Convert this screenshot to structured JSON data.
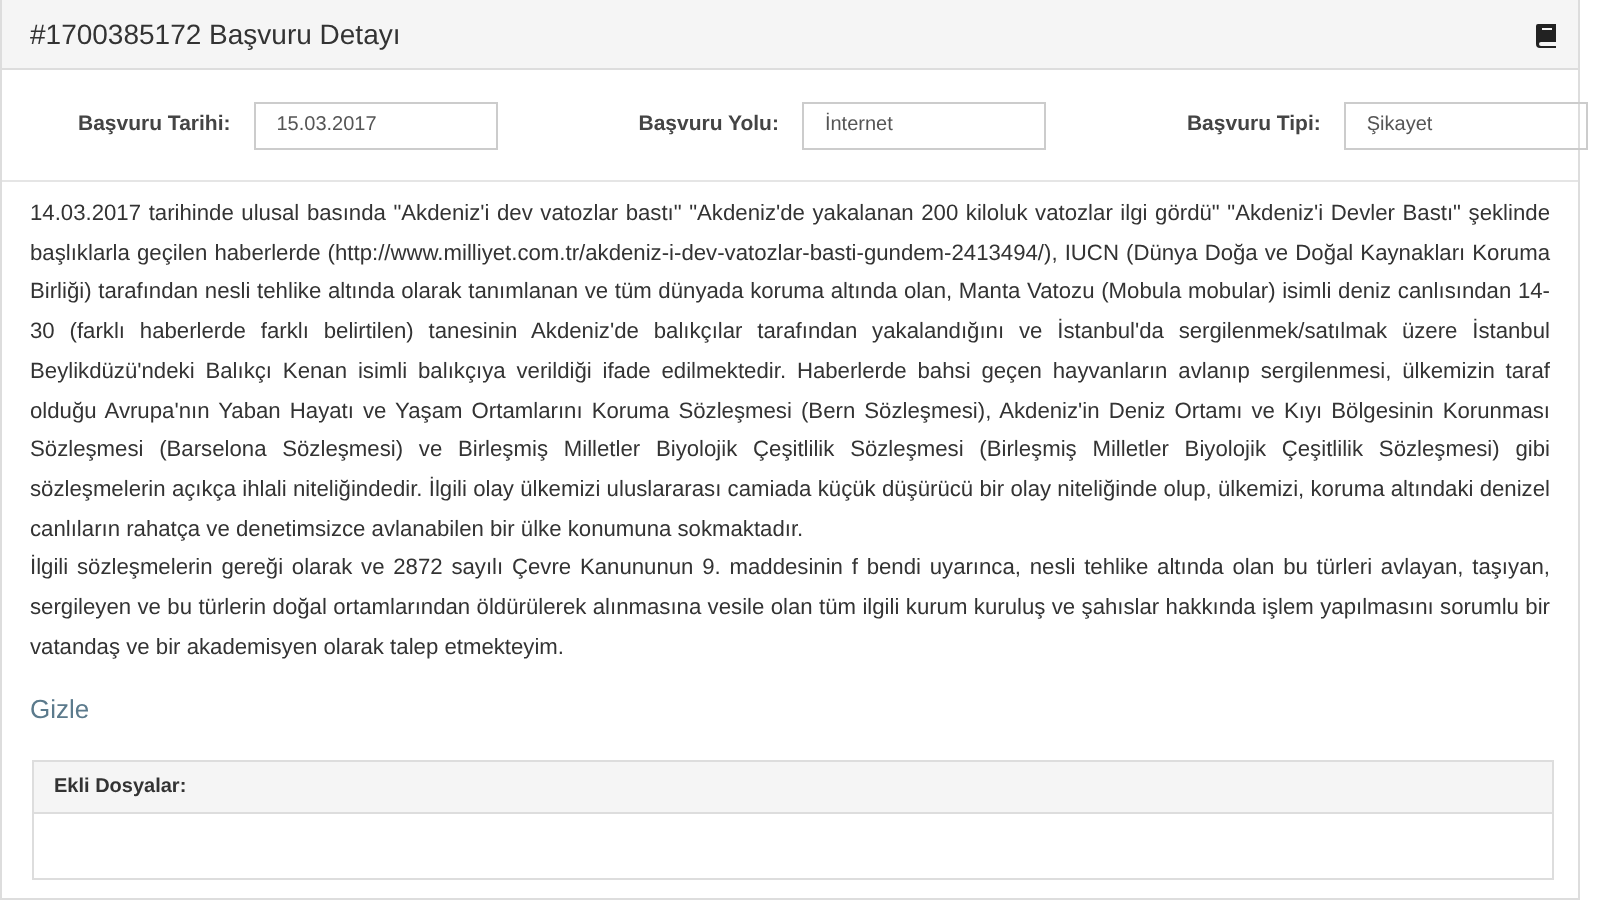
{
  "panel": {
    "title": "#1700385172 Başvuru Detayı"
  },
  "fields": [
    {
      "label": "Başvuru Tarihi:",
      "value": "15.03.2017"
    },
    {
      "label": "Başvuru Yolu:",
      "value": "İnternet"
    },
    {
      "label": "Başvuru Tipi:",
      "value": "Şikayet"
    }
  ],
  "description": [
    "14.03.2017 tarihinde ulusal basında \"Akdeniz'i dev vatozlar bastı\" \"Akdeniz'de yakalanan 200 kiloluk vatozlar ilgi gördü\" \"Akdeniz'i Devler Bastı\" şeklinde başlıklarla geçilen haberlerde (http://www.milliyet.com.tr/akdeniz-i-dev-vatozlar-basti-gundem-2413494/), IUCN (Dünya Doğa ve Doğal Kaynakları Koruma Birliği) tarafından nesli tehlike altında olarak tanımlanan ve tüm dünyada koruma altında olan, Manta Vatozu (Mobula mobular) isimli deniz canlısından 14-30 (farklı haberlerde farklı belirtilen) tanesinin Akdeniz'de balıkçılar tarafından yakalandığını ve İstanbul'da sergilenmek/satılmak üzere İstanbul Beylikdüzü'ndeki Balıkçı Kenan isimli balıkçıya verildiği ifade edilmektedir. Haberlerde bahsi geçen hayvanların avlanıp sergilenmesi, ülkemizin taraf olduğu Avrupa'nın Yaban Hayatı ve Yaşam Ortamlarını Koruma Sözleşmesi (Bern Sözleşmesi), Akdeniz'in Deniz Ortamı ve Kıyı Bölgesinin Korunması Sözleşmesi (Barselona Sözleşmesi) ve Birleşmiş Milletler Biyolojik Çeşitlilik Sözleşmesi (Birleşmiş Milletler Biyolojik Çeşitlilik Sözleşmesi) gibi sözleşmelerin açıkça ihlali niteliğindedir. İlgili olay ülkemizi uluslararası camiada küçük düşürücü bir olay niteliğinde olup, ülkemizi, koruma altındaki denizel canlıların rahatça ve denetimsizce avlanabilen bir ülke konumuna sokmaktadır.",
    "İlgili sözleşmelerin gereği olarak ve 2872 sayılı Çevre Kanununun 9. maddesinin f bendi uyarınca, nesli tehlike altında olan bu türleri avlayan, taşıyan, sergileyen ve bu türlerin doğal ortamlarından öldürülerek alınmasına vesile olan tüm ilgili kurum kuruluş ve şahıslar hakkında işlem yapılmasını sorumlu bir vatandaş ve bir akademisyen olarak talep etmekteyim."
  ],
  "toggle_link": "Gizle",
  "attachments": {
    "title": "Ekli Dosyalar:"
  }
}
